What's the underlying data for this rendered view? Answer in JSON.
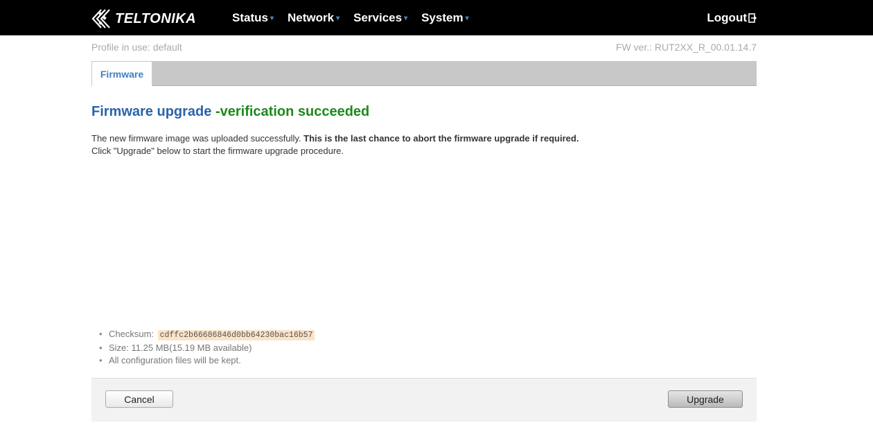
{
  "header": {
    "logo_text": "TELTONIKA",
    "nav": [
      {
        "label": "Status"
      },
      {
        "label": "Network"
      },
      {
        "label": "Services"
      },
      {
        "label": "System"
      }
    ],
    "logout_label": "Logout"
  },
  "subheader": {
    "profile": "Profile in use: default",
    "fw_version": "FW ver.: RUT2XX_R_00.01.14.7"
  },
  "tabs": [
    {
      "label": "Firmware",
      "active": true
    }
  ],
  "main": {
    "title_part1": "Firmware upgrade",
    "title_part2": " -verification succeeded",
    "desc_line1_normal": "The new firmware image was uploaded successfully. ",
    "desc_line1_bold": "This is the last chance to abort the firmware upgrade if required.",
    "desc_line2": "Click \"Upgrade\" below to start the firmware upgrade procedure.",
    "checksum_label": "Checksum: ",
    "checksum_value": "cdffc2b66686846d0bb64230bac16b57",
    "size_text": "Size: 11.25 MB(15.19 MB available)",
    "config_text": "All configuration files will be kept."
  },
  "footer": {
    "cancel_label": "Cancel",
    "upgrade_label": "Upgrade"
  },
  "colors": {
    "title_blue": "#2a63a8",
    "title_green": "#1b8a1b",
    "tab_text": "#3f7ec0",
    "nav_caret": "#4a86c5"
  }
}
